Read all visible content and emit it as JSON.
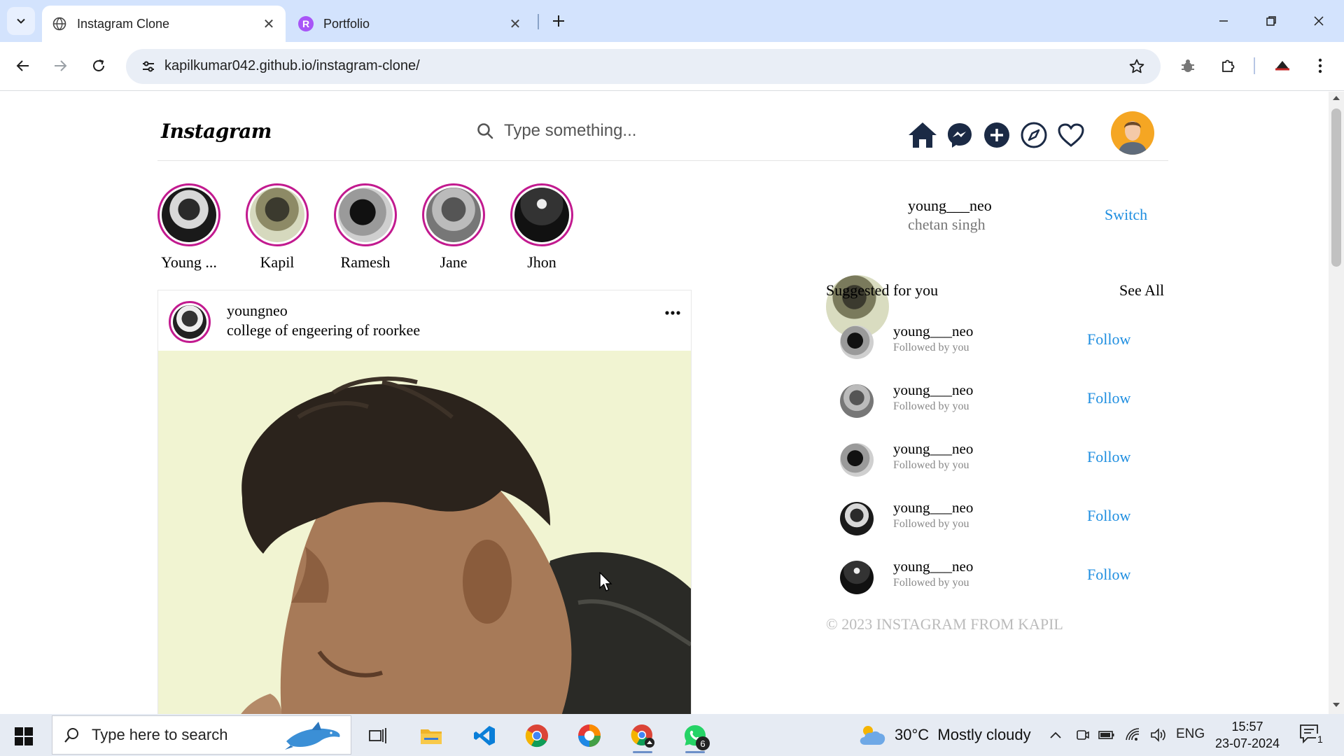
{
  "browser": {
    "tabs": [
      {
        "title": "Instagram Clone",
        "active": true
      },
      {
        "title": "Portfolio",
        "active": false
      }
    ],
    "url": "kapilkumar042.github.io/instagram-clone/"
  },
  "header": {
    "logo": "Instagram",
    "search_placeholder": "Type something..."
  },
  "stories": [
    {
      "name": "Young ..."
    },
    {
      "name": "Kapil"
    },
    {
      "name": "Ramesh"
    },
    {
      "name": "Jane"
    },
    {
      "name": "Jhon"
    }
  ],
  "post": {
    "username": "youngneo",
    "location": "college of engeering of roorkee"
  },
  "sidebar": {
    "username": "young___neo",
    "full_name": "chetan singh",
    "switch_label": "Switch",
    "suggested_title": "Suggested for you",
    "see_all_label": "See All",
    "suggestions": [
      {
        "username": "young___neo",
        "subtitle": "Followed by you",
        "action": "Follow"
      },
      {
        "username": "young___neo",
        "subtitle": "Followed by you",
        "action": "Follow"
      },
      {
        "username": "young___neo",
        "subtitle": "Followed by you",
        "action": "Follow"
      },
      {
        "username": "young___neo",
        "subtitle": "Followed by you",
        "action": "Follow"
      },
      {
        "username": "young___neo",
        "subtitle": "Followed by you",
        "action": "Follow"
      }
    ],
    "copyright": "© 2023 INSTAGRAM FROM KAPIL"
  },
  "taskbar": {
    "search_placeholder": "Type here to search",
    "whatsapp_badge": "6",
    "weather": "30°C  Mostly cloudy",
    "language": "ENG",
    "time": "15:57",
    "date": "23-07-2024",
    "notifications": "1"
  },
  "colors": {
    "accent": "#1e8ee0",
    "story_ring": "#c21a8f",
    "tab_bar": "#d3e3fd"
  }
}
